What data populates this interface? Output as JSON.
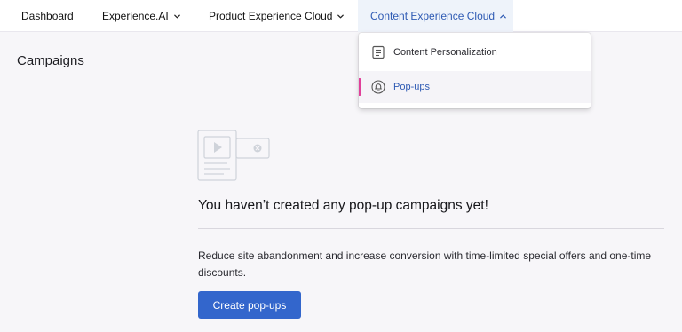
{
  "nav": {
    "items": [
      {
        "label": "Dashboard",
        "has_dropdown": false
      },
      {
        "label": "Experience.AI",
        "has_dropdown": true,
        "icon": "chevron-down-icon"
      },
      {
        "label": "Product Experience Cloud",
        "has_dropdown": true,
        "icon": "chevron-down-icon"
      },
      {
        "label": "Content Experience Cloud",
        "has_dropdown": true,
        "icon": "chevron-up-icon",
        "active": true
      }
    ]
  },
  "dropdown": {
    "items": [
      {
        "label": "Content Personalization",
        "icon": "document-icon"
      },
      {
        "label": "Pop-ups",
        "icon": "bell-icon",
        "selected": true
      }
    ]
  },
  "page": {
    "title": "Campaigns"
  },
  "empty_state": {
    "illustration": "popup-illustration-icon",
    "heading": "You haven’t created any pop-up campaigns yet!",
    "description": "Reduce site abandonment and increase conversion with time-limited special offers and one-time discounts.",
    "cta_label": "Create pop-ups"
  },
  "colors": {
    "accent": "#3366cc",
    "active_text": "#2f5bb4",
    "selected_marker": "#e0409a",
    "background": "#f7f6f9"
  }
}
